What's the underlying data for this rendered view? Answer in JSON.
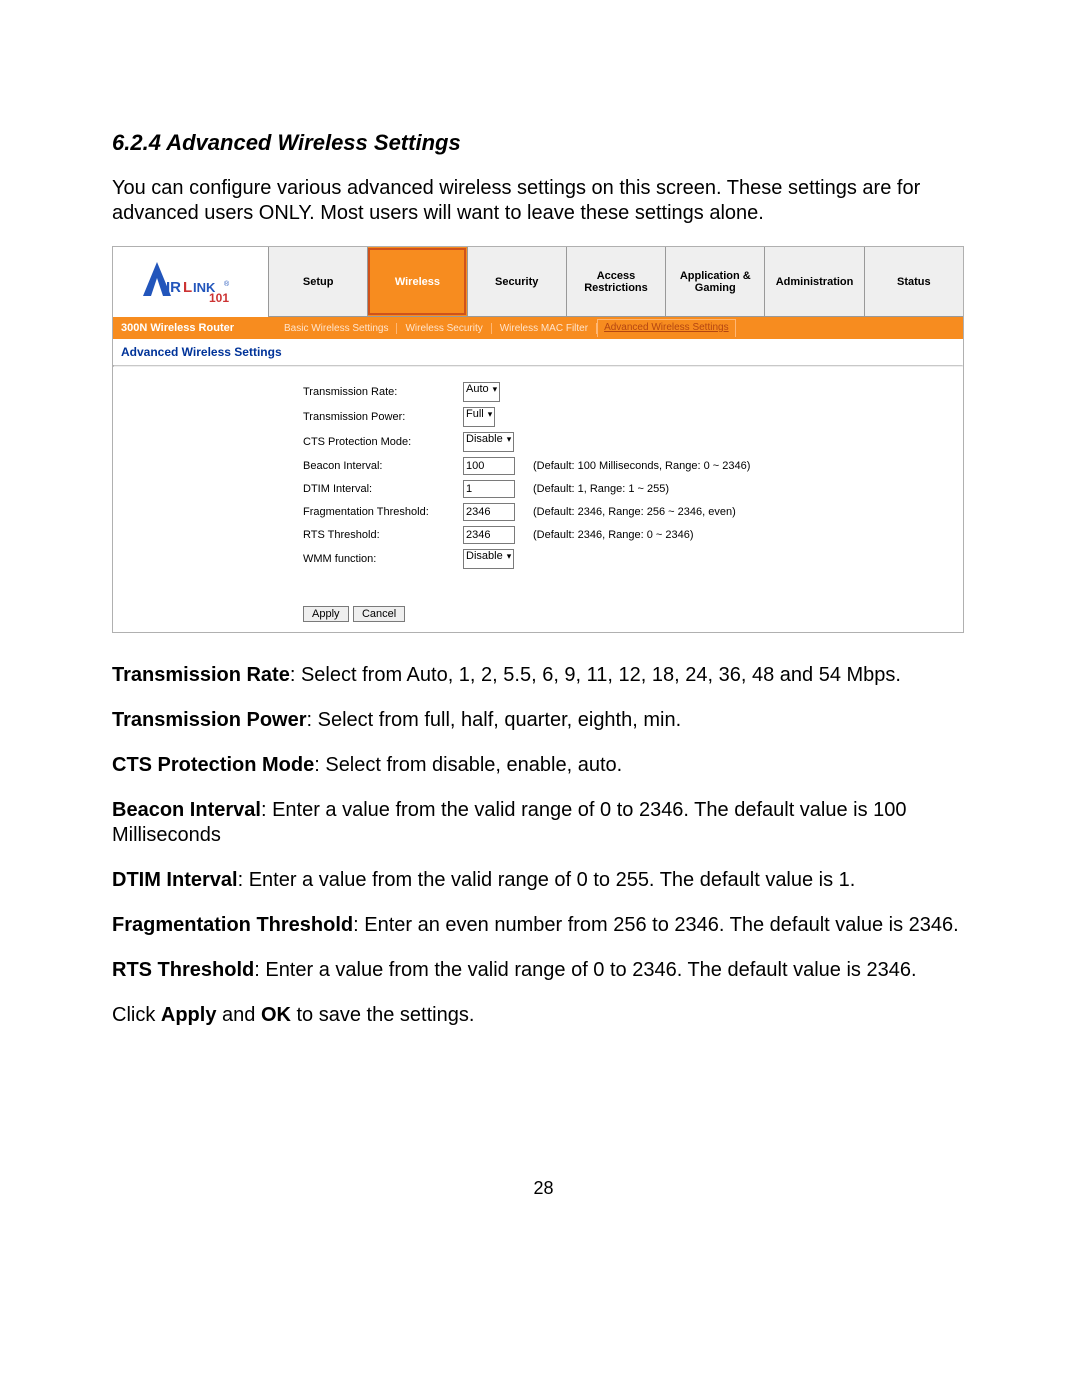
{
  "section_heading": "6.2.4 Advanced Wireless Settings",
  "intro_line1": "You can configure various advanced wireless settings on this screen.  These settings are for advanced users ONLY.  Most users will want to leave these settings alone.",
  "router": {
    "logo_brand": "AirLink 101",
    "router_model": "300N Wireless Router",
    "primary_tabs": [
      "Setup",
      "Wireless",
      "Security",
      "Access Restrictions",
      "Application & Gaming",
      "Administration",
      "Status"
    ],
    "active_primary": "Wireless",
    "sub_tabs": [
      "Basic Wireless Settings",
      "Wireless Security",
      "Wireless MAC Filter",
      "Advanced Wireless Settings"
    ],
    "active_sub": "Advanced Wireless Settings",
    "page_label": "Advanced Wireless Settings",
    "form": {
      "transmission_rate": {
        "label": "Transmission Rate:",
        "value": "Auto"
      },
      "transmission_power": {
        "label": "Transmission Power:",
        "value": "Full"
      },
      "cts_mode": {
        "label": "CTS Protection Mode:",
        "value": "Disable"
      },
      "beacon": {
        "label": "Beacon Interval:",
        "value": "100",
        "hint": "(Default: 100 Milliseconds, Range: 0 ~ 2346)"
      },
      "dtim": {
        "label": "DTIM Interval:",
        "value": "1",
        "hint": "(Default: 1, Range: 1 ~ 255)"
      },
      "frag": {
        "label": "Fragmentation Threshold:",
        "value": "2346",
        "hint": "(Default: 2346, Range: 256 ~ 2346, even)"
      },
      "rts": {
        "label": "RTS Threshold:",
        "value": "2346",
        "hint": "(Default: 2346, Range: 0 ~ 2346)"
      },
      "wmm": {
        "label": "WMM function:",
        "value": "Disable"
      }
    },
    "buttons": {
      "apply": "Apply",
      "cancel": "Cancel"
    }
  },
  "desc": {
    "tx_rate_b": "Transmission Rate",
    "tx_rate_t": ": Select from Auto, 1, 2, 5.5, 6, 9, 11, 12, 18, 24, 36, 48 and 54 Mbps.",
    "tx_pow_b": "Transmission Power",
    "tx_pow_t": ": Select from full, half, quarter, eighth, min.",
    "cts_b": "CTS Protection Mode",
    "cts_t": ": Select from disable, enable, auto.",
    "beacon_b": "Beacon Interval",
    "beacon_t": ": Enter a value from the valid range of 0 to 2346. The default value is 100 Milliseconds",
    "dtim_b": "DTIM Interval",
    "dtim_t": ": Enter a value from the valid range of 0 to 255. The default value is 1.",
    "frag_b": "Fragmentation Threshold",
    "frag_t": ": Enter an even number from 256 to 2346. The default value is 2346.",
    "rts_b": "RTS Threshold",
    "rts_t": ": Enter a value from the valid range of 0 to 2346. The default value is 2346.",
    "final1": "Click ",
    "final_apply": "Apply",
    "final_and": " and ",
    "final_ok": "OK",
    "final2": " to save the settings."
  },
  "page_number": "28"
}
